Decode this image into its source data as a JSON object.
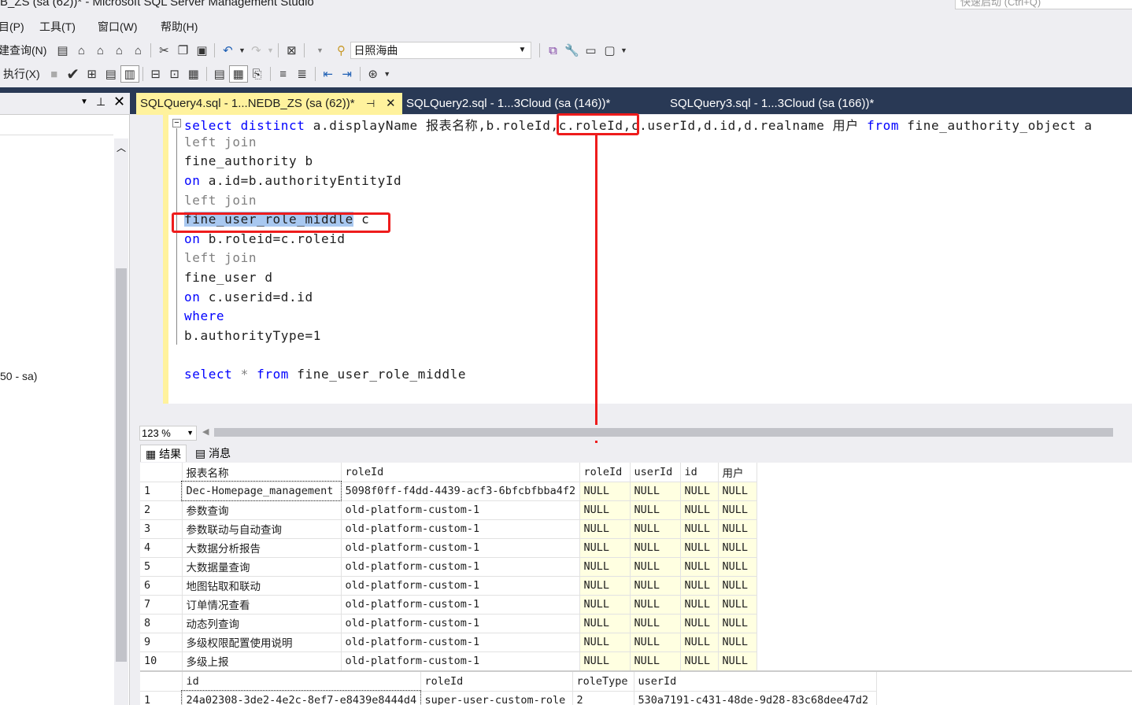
{
  "window": {
    "title": "B_ZS (sa (62))* - Microsoft SQL Server Management Studio",
    "quick_launch": "快速启动 (Ctrl+Q)"
  },
  "menu": {
    "project": "目(P)",
    "tools": "工具(T)",
    "window": "窗口(W)",
    "help": "帮助(H)"
  },
  "toolbar": {
    "new_query": "建查询(N)",
    "execute": "执行(X)",
    "database": "日照海曲"
  },
  "tabs": [
    "SQLQuery4.sql - 1...NEDB_ZS (sa (62))*",
    "SQLQuery2.sql - 1...3Cloud (sa (146))*",
    "SQLQuery3.sql - 1...3Cloud (sa (166))*"
  ],
  "left_panel": {
    "conn_text": "50 - sa)"
  },
  "editor": {
    "line1": {
      "kw1": "select",
      "kw2": "distinct",
      "t1": "a.displayName 报表名称,b.roleId,",
      "boxed": "c.roleId,",
      "t2": "c.userId,d.id,d.realname 用户",
      "kw3": "from",
      "t3": "fine_authority_object a"
    },
    "line2": "left join",
    "line3": "fine_authority b",
    "line4": {
      "kw": "on",
      "text": "a.id=b.authorityEntityId"
    },
    "line5": "left join",
    "line6": {
      "hl": "fine_user_role_middle",
      "text": " c"
    },
    "line7": {
      "kw": "on",
      "text": "b.roleid=c.roleid"
    },
    "line8": "left join",
    "line9": "fine_user d",
    "line10": {
      "kw": "on",
      "text": "c.userid=d.id"
    },
    "line11": "where",
    "line12": "b.authorityType=1",
    "line14": {
      "kw1": "select",
      "t1": "*",
      "kw2": "from",
      "t2": "fine_user_role_middle"
    }
  },
  "zoom": "123 %",
  "result_tabs": {
    "results": "结果",
    "messages": "消息"
  },
  "grid1": {
    "headers": [
      "报表名称",
      "roleId",
      "roleId",
      "userId",
      "id",
      "用户"
    ],
    "rows": [
      [
        "1",
        "Dec-Homepage_management",
        "5098f0ff-f4dd-4439-acf3-6bfcbfbba4f2",
        "NULL",
        "NULL",
        "NULL",
        "NULL"
      ],
      [
        "2",
        "参数查询",
        "old-platform-custom-1",
        "NULL",
        "NULL",
        "NULL",
        "NULL"
      ],
      [
        "3",
        "参数联动与自动查询",
        "old-platform-custom-1",
        "NULL",
        "NULL",
        "NULL",
        "NULL"
      ],
      [
        "4",
        "大数据分析报告",
        "old-platform-custom-1",
        "NULL",
        "NULL",
        "NULL",
        "NULL"
      ],
      [
        "5",
        "大数据量查询",
        "old-platform-custom-1",
        "NULL",
        "NULL",
        "NULL",
        "NULL"
      ],
      [
        "6",
        "地图钻取和联动",
        "old-platform-custom-1",
        "NULL",
        "NULL",
        "NULL",
        "NULL"
      ],
      [
        "7",
        "订单情况查看",
        "old-platform-custom-1",
        "NULL",
        "NULL",
        "NULL",
        "NULL"
      ],
      [
        "8",
        "动态列查询",
        "old-platform-custom-1",
        "NULL",
        "NULL",
        "NULL",
        "NULL"
      ],
      [
        "9",
        "多级权限配置使用说明",
        "old-platform-custom-1",
        "NULL",
        "NULL",
        "NULL",
        "NULL"
      ],
      [
        "10",
        "多级上报",
        "old-platform-custom-1",
        "NULL",
        "NULL",
        "NULL",
        "NULL"
      ]
    ]
  },
  "grid2": {
    "headers": [
      "id",
      "roleId",
      "roleType",
      "userId"
    ],
    "rows": [
      [
        "1",
        "24a02308-3de2-4e2c-8ef7-e8439e8444d4",
        "super-user-custom-role",
        "2",
        "530a7191-c431-48de-9d28-83c68dee47d2"
      ]
    ]
  },
  "colors": {
    "accent_tab": "#fff29d",
    "tab_band": "#293955",
    "annotation": "#ee1c1c",
    "null_cell": "#ffffe1"
  }
}
